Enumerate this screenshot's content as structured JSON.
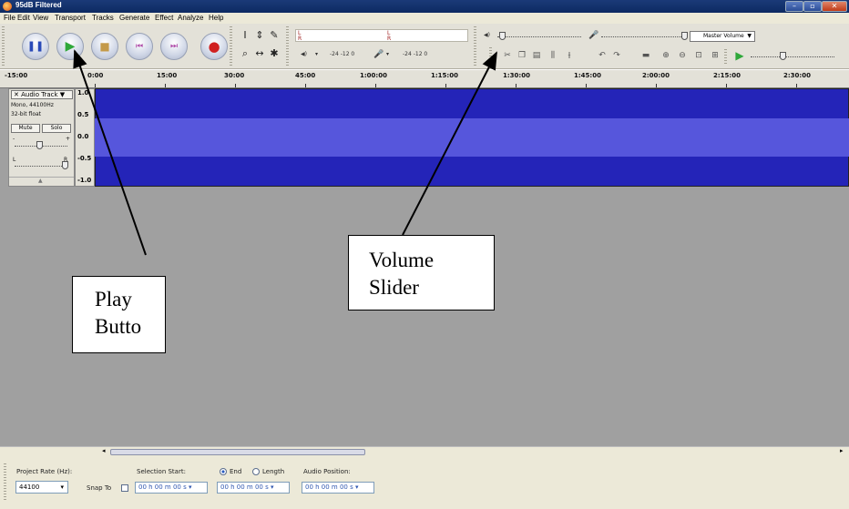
{
  "window": {
    "title": "95dB Filtered"
  },
  "menu": [
    "File",
    "Edit",
    "View",
    "Transport",
    "Tracks",
    "Generate",
    "Effect",
    "Analyze",
    "Help"
  ],
  "transport": {
    "pause_icon": "pause-icon",
    "play_icon": "play-icon",
    "stop_icon": "stop-icon",
    "skip_start_icon": "skip-to-start-icon",
    "skip_end_icon": "skip-to-end-icon",
    "record_icon": "record-icon"
  },
  "meters": {
    "play_channels": [
      "L",
      "R"
    ],
    "record_channels": [
      "L",
      "R"
    ],
    "scale_text": "-24  -12  0"
  },
  "mixer": {
    "device_select": "Master Volume"
  },
  "ruler": {
    "ticks": [
      "-15:00",
      "0:00",
      "15:00",
      "30:00",
      "45:00",
      "1:00:00",
      "1:15:00",
      "1:30:00",
      "1:45:00",
      "2:00:00",
      "2:15:00",
      "2:30:00"
    ]
  },
  "track": {
    "title": "Audio Track",
    "format_rate": "Mono, 44100Hz",
    "format_bits": "32-bit float",
    "mute_label": "Mute",
    "solo_label": "Solo",
    "gain_left": "-",
    "gain_right": "+",
    "pan_left": "L",
    "pan_right": "R",
    "scale": [
      "1.0",
      "0.5",
      "0.0",
      "-0.5",
      "-1.0"
    ]
  },
  "annotations": {
    "play": [
      "Play",
      "Butto"
    ],
    "volume": [
      "Volume",
      "Slider"
    ]
  },
  "status": {
    "project_rate_label": "Project Rate (Hz):",
    "project_rate_value": "44100",
    "snap_to_label": "Snap To",
    "selection_start_label": "Selection Start:",
    "end_label": "End",
    "length_label": "Length",
    "audio_position_label": "Audio Position:",
    "selection_start_value": "00 h 00 m 00 s",
    "end_value": "00 h 00 m 00 s",
    "audio_position_value": "00 h 00 m 00 s"
  },
  "colors": {
    "waveform": "#2424b8",
    "waveform_highlight": "#5656dc",
    "background": "#a0a0a0",
    "play_green": "#2fa83a",
    "record_red": "#d02020"
  }
}
